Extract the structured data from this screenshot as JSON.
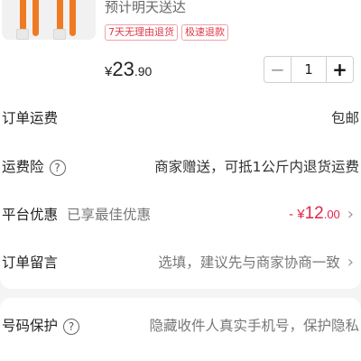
{
  "product": {
    "delivery": "预计明天送达",
    "tags": [
      "7天无理由退货",
      "极速退款"
    ],
    "price": {
      "currency": "¥",
      "integer": "23",
      "decimal": ".90"
    },
    "quantity": "1",
    "minus": "−",
    "plus": "+"
  },
  "order_shipping": {
    "label": "订单运费",
    "value": "包邮"
  },
  "shipping_insurance": {
    "label": "运费险",
    "help": "?",
    "value": "商家赠送，可抵1公斤内退货运费"
  },
  "platform_discount": {
    "label": "平台优惠",
    "note": "已享最佳优惠",
    "prefix": "- ¥",
    "integer": "12",
    "decimal": ".00",
    "chevron": "›"
  },
  "order_message": {
    "label": "订单留言",
    "placeholder": "选填，建议先与商家协商一致",
    "chevron": "›"
  },
  "number_protection": {
    "label": "号码保护",
    "help": "?",
    "value": "隐藏收件人真实手机号，保护隐私"
  },
  "colors": {
    "accent": "#e3264b",
    "cable": "#f07a22",
    "tag_border": "#f0a2a9"
  }
}
